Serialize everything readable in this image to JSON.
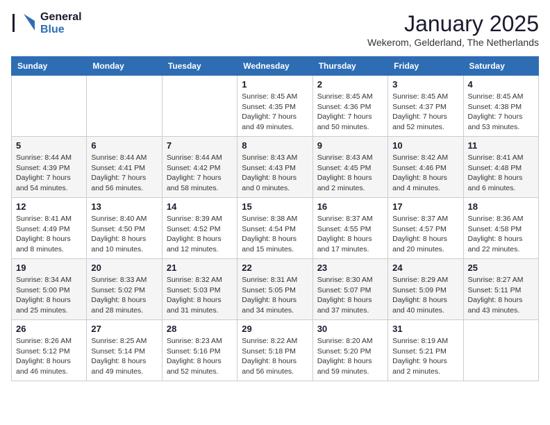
{
  "logo": {
    "line1": "General",
    "line2": "Blue"
  },
  "header": {
    "month": "January 2025",
    "location": "Wekerom, Gelderland, The Netherlands"
  },
  "days_of_week": [
    "Sunday",
    "Monday",
    "Tuesday",
    "Wednesday",
    "Thursday",
    "Friday",
    "Saturday"
  ],
  "weeks": [
    [
      {
        "day": "",
        "info": ""
      },
      {
        "day": "",
        "info": ""
      },
      {
        "day": "",
        "info": ""
      },
      {
        "day": "1",
        "info": "Sunrise: 8:45 AM\nSunset: 4:35 PM\nDaylight: 7 hours\nand 49 minutes."
      },
      {
        "day": "2",
        "info": "Sunrise: 8:45 AM\nSunset: 4:36 PM\nDaylight: 7 hours\nand 50 minutes."
      },
      {
        "day": "3",
        "info": "Sunrise: 8:45 AM\nSunset: 4:37 PM\nDaylight: 7 hours\nand 52 minutes."
      },
      {
        "day": "4",
        "info": "Sunrise: 8:45 AM\nSunset: 4:38 PM\nDaylight: 7 hours\nand 53 minutes."
      }
    ],
    [
      {
        "day": "5",
        "info": "Sunrise: 8:44 AM\nSunset: 4:39 PM\nDaylight: 7 hours\nand 54 minutes."
      },
      {
        "day": "6",
        "info": "Sunrise: 8:44 AM\nSunset: 4:41 PM\nDaylight: 7 hours\nand 56 minutes."
      },
      {
        "day": "7",
        "info": "Sunrise: 8:44 AM\nSunset: 4:42 PM\nDaylight: 7 hours\nand 58 minutes."
      },
      {
        "day": "8",
        "info": "Sunrise: 8:43 AM\nSunset: 4:43 PM\nDaylight: 8 hours\nand 0 minutes."
      },
      {
        "day": "9",
        "info": "Sunrise: 8:43 AM\nSunset: 4:45 PM\nDaylight: 8 hours\nand 2 minutes."
      },
      {
        "day": "10",
        "info": "Sunrise: 8:42 AM\nSunset: 4:46 PM\nDaylight: 8 hours\nand 4 minutes."
      },
      {
        "day": "11",
        "info": "Sunrise: 8:41 AM\nSunset: 4:48 PM\nDaylight: 8 hours\nand 6 minutes."
      }
    ],
    [
      {
        "day": "12",
        "info": "Sunrise: 8:41 AM\nSunset: 4:49 PM\nDaylight: 8 hours\nand 8 minutes."
      },
      {
        "day": "13",
        "info": "Sunrise: 8:40 AM\nSunset: 4:50 PM\nDaylight: 8 hours\nand 10 minutes."
      },
      {
        "day": "14",
        "info": "Sunrise: 8:39 AM\nSunset: 4:52 PM\nDaylight: 8 hours\nand 12 minutes."
      },
      {
        "day": "15",
        "info": "Sunrise: 8:38 AM\nSunset: 4:54 PM\nDaylight: 8 hours\nand 15 minutes."
      },
      {
        "day": "16",
        "info": "Sunrise: 8:37 AM\nSunset: 4:55 PM\nDaylight: 8 hours\nand 17 minutes."
      },
      {
        "day": "17",
        "info": "Sunrise: 8:37 AM\nSunset: 4:57 PM\nDaylight: 8 hours\nand 20 minutes."
      },
      {
        "day": "18",
        "info": "Sunrise: 8:36 AM\nSunset: 4:58 PM\nDaylight: 8 hours\nand 22 minutes."
      }
    ],
    [
      {
        "day": "19",
        "info": "Sunrise: 8:34 AM\nSunset: 5:00 PM\nDaylight: 8 hours\nand 25 minutes."
      },
      {
        "day": "20",
        "info": "Sunrise: 8:33 AM\nSunset: 5:02 PM\nDaylight: 8 hours\nand 28 minutes."
      },
      {
        "day": "21",
        "info": "Sunrise: 8:32 AM\nSunset: 5:03 PM\nDaylight: 8 hours\nand 31 minutes."
      },
      {
        "day": "22",
        "info": "Sunrise: 8:31 AM\nSunset: 5:05 PM\nDaylight: 8 hours\nand 34 minutes."
      },
      {
        "day": "23",
        "info": "Sunrise: 8:30 AM\nSunset: 5:07 PM\nDaylight: 8 hours\nand 37 minutes."
      },
      {
        "day": "24",
        "info": "Sunrise: 8:29 AM\nSunset: 5:09 PM\nDaylight: 8 hours\nand 40 minutes."
      },
      {
        "day": "25",
        "info": "Sunrise: 8:27 AM\nSunset: 5:11 PM\nDaylight: 8 hours\nand 43 minutes."
      }
    ],
    [
      {
        "day": "26",
        "info": "Sunrise: 8:26 AM\nSunset: 5:12 PM\nDaylight: 8 hours\nand 46 minutes."
      },
      {
        "day": "27",
        "info": "Sunrise: 8:25 AM\nSunset: 5:14 PM\nDaylight: 8 hours\nand 49 minutes."
      },
      {
        "day": "28",
        "info": "Sunrise: 8:23 AM\nSunset: 5:16 PM\nDaylight: 8 hours\nand 52 minutes."
      },
      {
        "day": "29",
        "info": "Sunrise: 8:22 AM\nSunset: 5:18 PM\nDaylight: 8 hours\nand 56 minutes."
      },
      {
        "day": "30",
        "info": "Sunrise: 8:20 AM\nSunset: 5:20 PM\nDaylight: 8 hours\nand 59 minutes."
      },
      {
        "day": "31",
        "info": "Sunrise: 8:19 AM\nSunset: 5:21 PM\nDaylight: 9 hours\nand 2 minutes."
      },
      {
        "day": "",
        "info": ""
      }
    ]
  ]
}
